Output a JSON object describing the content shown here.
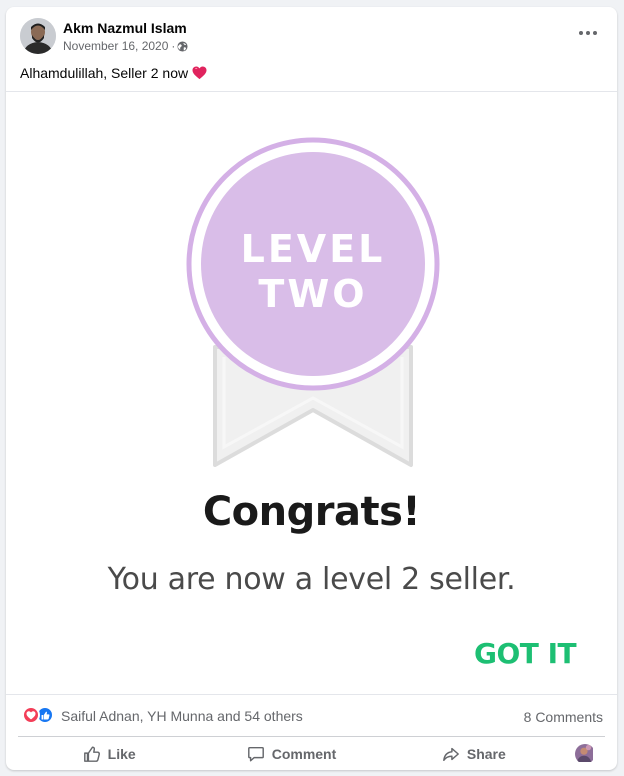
{
  "post": {
    "author": "Akm Nazmul Islam",
    "date": "November 16, 2020",
    "separator": "·",
    "privacy_icon": "globe-icon",
    "caption": "Alhamdulillah, Seller 2 now",
    "caption_emoji": "red-heart-emoji"
  },
  "media": {
    "badge_line1": "LEVEL",
    "badge_line2": "TWO",
    "headline": "Congrats!",
    "subtitle": "You are now a level 2 seller.",
    "button_label": "GOT IT",
    "colors": {
      "badge_fill": "#d9bde8",
      "badge_ring": "#cfa9e3",
      "ribbon_fill": "#f0f0f0",
      "ribbon_stroke": "#dcdcdc",
      "button_text": "#1dbf73"
    }
  },
  "reactions": {
    "icons": [
      "love-reaction-icon",
      "like-reaction-icon"
    ],
    "names": "Saiful Adnan, YH Munna and 54 others",
    "comments": "8 Comments"
  },
  "actions": {
    "like": "Like",
    "comment": "Comment",
    "share": "Share"
  },
  "colors": {
    "text_secondary": "#65676b",
    "like_blue": "#1877f2",
    "love_red": "#f33e58"
  }
}
